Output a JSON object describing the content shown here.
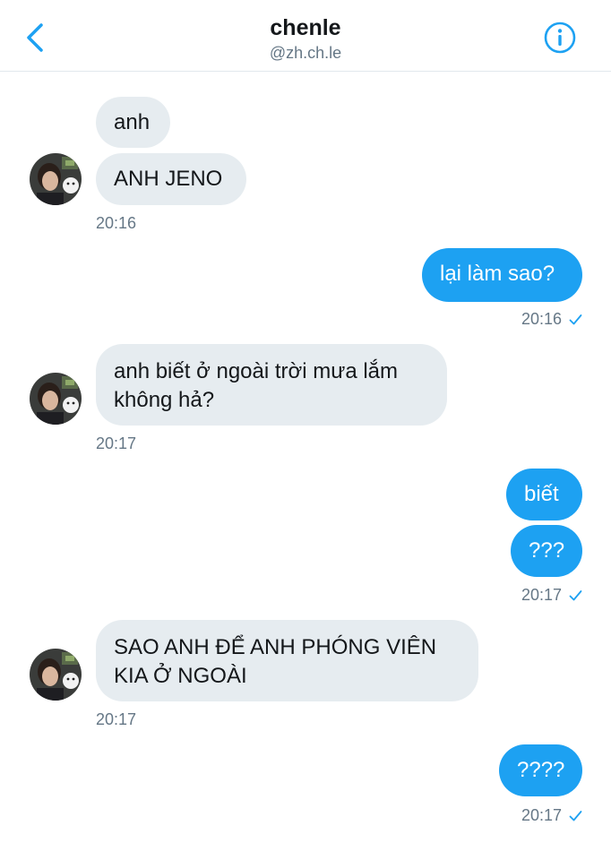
{
  "header": {
    "title": "chenle",
    "handle": "@zh.ch.le",
    "back_icon": "chevron-left-icon",
    "info_icon": "info-circle-icon"
  },
  "colors": {
    "accent": "#1da1f2",
    "incoming_bubble": "#e6ecf0",
    "timestamp": "#657786"
  },
  "messages": [
    {
      "direction": "in",
      "text": "anh"
    },
    {
      "direction": "in",
      "text": "ANH JENO",
      "time": "20:16"
    },
    {
      "direction": "out",
      "text": "lại làm sao?",
      "time": "20:16"
    },
    {
      "direction": "in",
      "lines": [
        "anh biết ở ngoài trời mưa lắm",
        "không hả?"
      ],
      "time": "20:17"
    },
    {
      "direction": "out",
      "text": "biết"
    },
    {
      "direction": "out",
      "text": "???",
      "time": "20:17"
    },
    {
      "direction": "in",
      "lines": [
        "SAO ANH ĐỂ ANH PHÓNG VIÊN",
        "KIA Ở NGOÀI"
      ],
      "time": "20:17"
    },
    {
      "direction": "out",
      "text": "????",
      "time": "20:17"
    }
  ]
}
